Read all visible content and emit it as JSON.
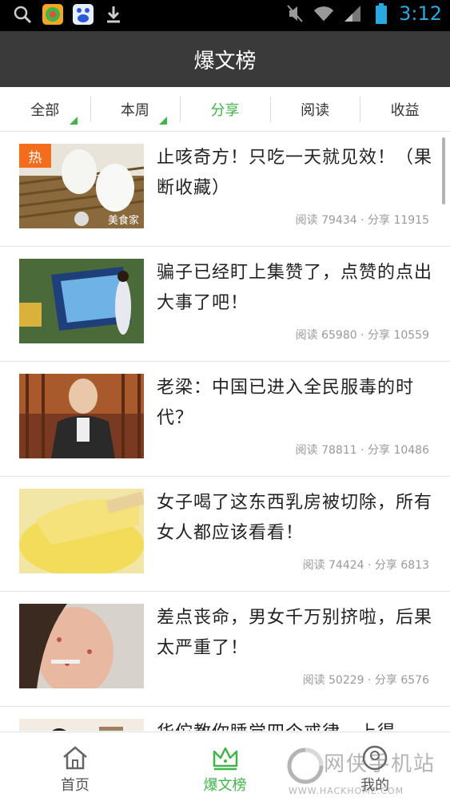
{
  "status_bar": {
    "time": "3:12",
    "left_icons": [
      "search-icon",
      "app-store-icon",
      "baidu-icon",
      "download-icon"
    ],
    "right_icons": [
      "mute-icon",
      "wifi-icon",
      "signal-icon",
      "battery-icon"
    ]
  },
  "header": {
    "title": "爆文榜"
  },
  "tabs": [
    {
      "label": "全部",
      "has_dropdown": true
    },
    {
      "label": "本周",
      "has_dropdown": true
    },
    {
      "label": "分享",
      "active": true
    },
    {
      "label": "阅读"
    },
    {
      "label": "收益"
    }
  ],
  "articles": [
    {
      "title": "止咳奇方！只吃一天就见效！（果断收藏）",
      "stats": "阅读 79434 · 分享 11915",
      "badge": "热",
      "thumb_watermark": "美食家"
    },
    {
      "title": "骗子已经盯上集赞了，点赞的点出大事了吧！",
      "stats": "阅读 65980 · 分享 10559"
    },
    {
      "title": "老梁：中国已进入全民服毒的时代？",
      "stats": "阅读 78811 · 分享 10486"
    },
    {
      "title": "女子喝了这东西乳房被切除，所有女人都应该看看！",
      "stats": "阅读 74424 · 分享 6813"
    },
    {
      "title": "差点丧命，男女千万别挤啦，后果太严重了！",
      "stats": "阅读 50229 · 分享 6576"
    },
    {
      "title": "华佗教你睡觉四个戒律，上得",
      "stats": ""
    }
  ],
  "bottom_nav": [
    {
      "label": "首页",
      "icon": "home-icon"
    },
    {
      "label": "爆文榜",
      "icon": "crown-icon",
      "active": true
    },
    {
      "label": "我的",
      "icon": "user-icon"
    }
  ],
  "watermark": {
    "line1": "网侠手机站",
    "line2": "WWW.HACKHOME.COM"
  },
  "colors": {
    "accent": "#3fb548",
    "header_bg": "#3a3a3a",
    "hot_badge": "#f36d1c",
    "clock": "#2aa9e0"
  }
}
